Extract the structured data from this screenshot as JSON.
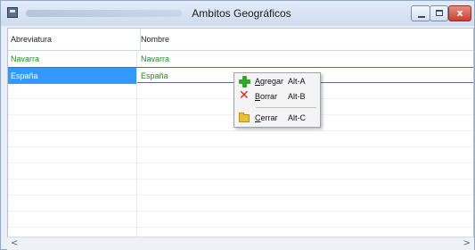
{
  "window": {
    "title": "Ambitos Geográficos",
    "close_glyph": "x"
  },
  "columns": [
    "Abreviatura",
    "Nombre"
  ],
  "rows": [
    {
      "abreviatura": "Navarra",
      "nombre": "Navarra",
      "selected": false
    },
    {
      "abreviatura": "España",
      "nombre": "España",
      "selected": true
    }
  ],
  "context_menu": {
    "items": [
      {
        "underline": "A",
        "rest": "gregar",
        "shortcut": "Alt-A",
        "icon": "plus-icon"
      },
      {
        "underline": "B",
        "rest": "orrar",
        "shortcut": "Alt-B",
        "icon": "delete-x-icon"
      },
      {
        "underline": "C",
        "rest": "errar",
        "shortcut": "Alt-C",
        "icon": "folder-icon"
      }
    ]
  },
  "scrollbar": {
    "left_arrow": "<",
    "right_arrow": ">"
  },
  "colors": {
    "selection": "#3399ff",
    "row_text": "#1f8a1f",
    "close_button": "#c8402d"
  }
}
